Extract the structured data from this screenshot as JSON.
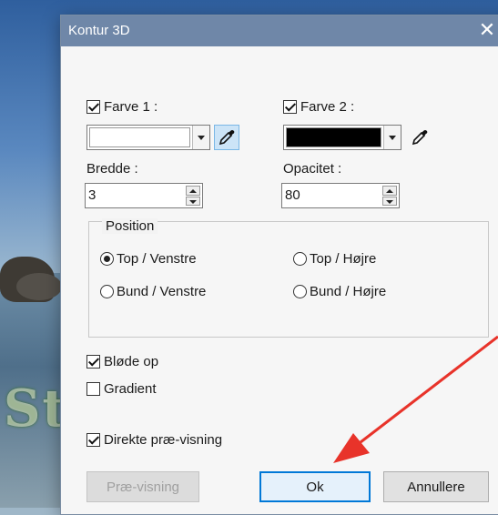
{
  "background": {
    "overlay_text": "Storebælt"
  },
  "dialog": {
    "title": "Kontur 3D",
    "close_glyph": "✕",
    "color1": {
      "label": "Farve 1 :",
      "checked": true,
      "swatch_color": "#ffffff",
      "picker_active": true
    },
    "color2": {
      "label": "Farve 2 :",
      "checked": true,
      "swatch_color": "#000000",
      "picker_active": false
    },
    "width": {
      "label": "Bredde :",
      "value": "3"
    },
    "opacity": {
      "label": "Opacitet :",
      "value": "80"
    },
    "position": {
      "legend": "Position",
      "options": [
        {
          "label": "Top / Venstre",
          "selected": true
        },
        {
          "label": "Top / Højre",
          "selected": false
        },
        {
          "label": "Bund / Venstre",
          "selected": false
        },
        {
          "label": "Bund / Højre",
          "selected": false
        }
      ]
    },
    "soft_up": {
      "label": "Bløde op",
      "checked": true
    },
    "gradient": {
      "label": "Gradient",
      "checked": false
    },
    "direct_preview": {
      "label": "Direkte præ-visning",
      "checked": true
    },
    "buttons": {
      "preview": "Præ-visning",
      "ok": "Ok",
      "cancel": "Annullere"
    }
  },
  "annotation": {
    "arrow_color": "#e8332a"
  }
}
